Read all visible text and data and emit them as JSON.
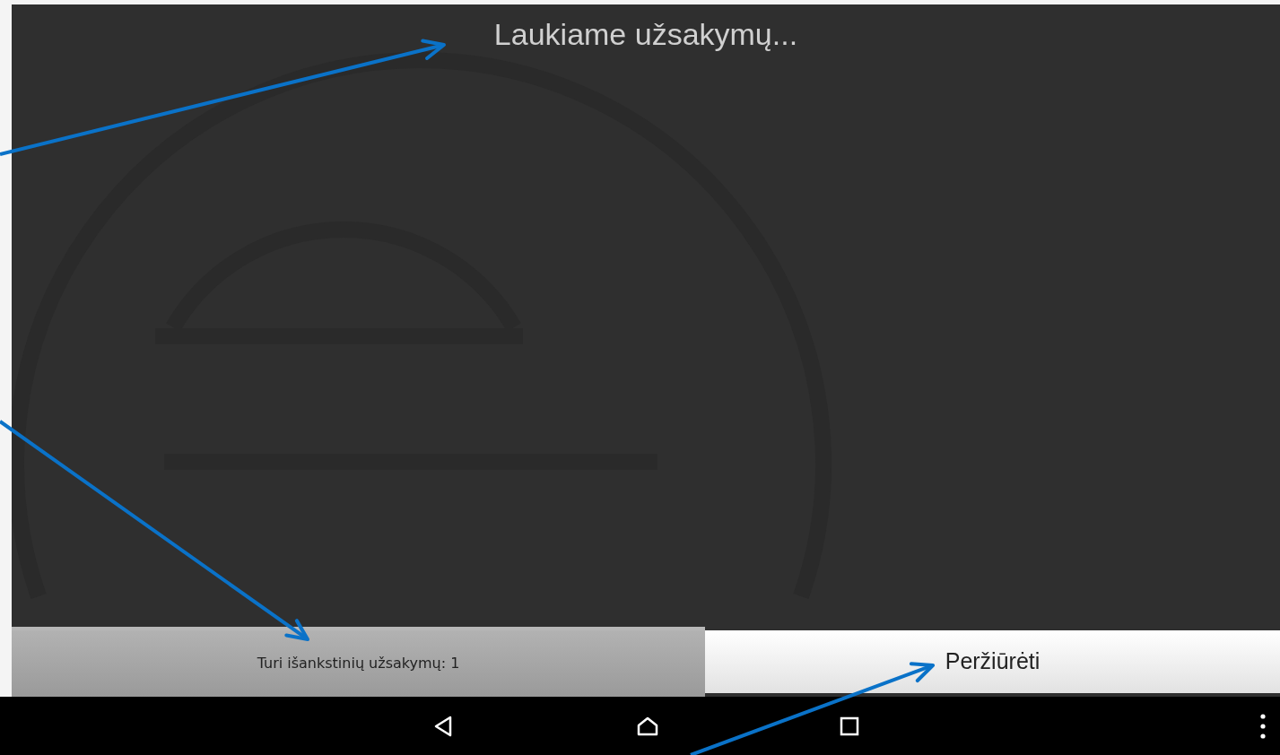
{
  "screen": {
    "title": "Laukiame užsakymų..."
  },
  "bottom_bar": {
    "pre_orders_text": "Turi išankstinių užsakymų: 1",
    "view_button": "Peržiūrėti"
  },
  "nav_bar": {
    "buttons": [
      {
        "kind": "back"
      },
      {
        "kind": "home"
      },
      {
        "kind": "recents"
      },
      {
        "kind": "menu"
      }
    ]
  }
}
